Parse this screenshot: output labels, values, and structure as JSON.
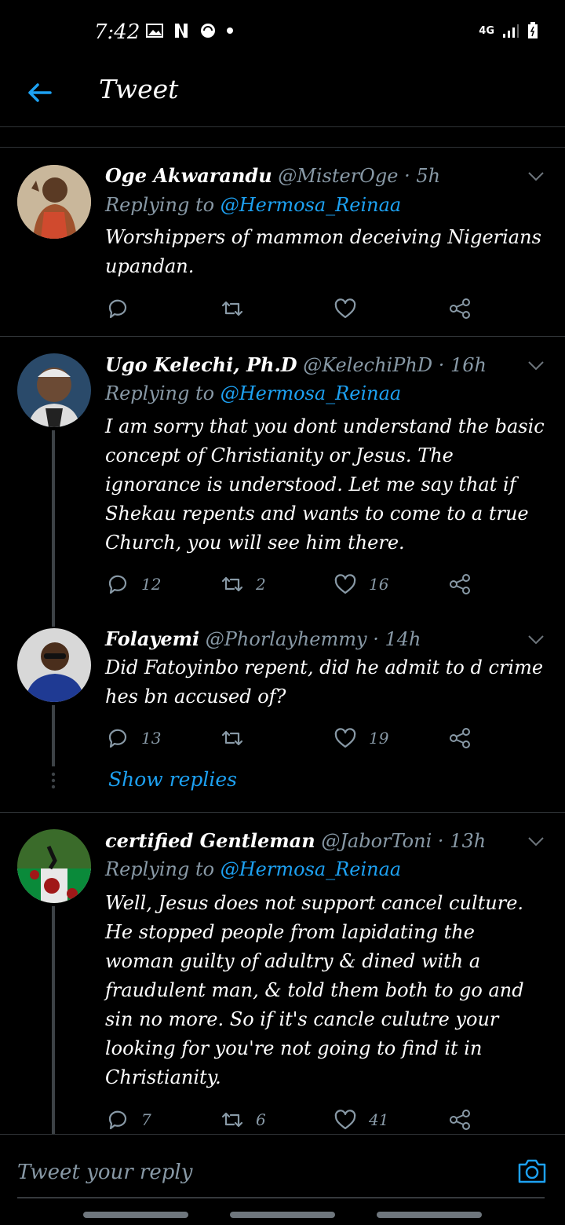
{
  "status_bar": {
    "time": "7:42",
    "network": "4G"
  },
  "header": {
    "title": "Tweet"
  },
  "tweets": [
    {
      "name": "Oge Akwarandu",
      "handle": "@MisterOge",
      "time": "5h",
      "replying_label": "Replying to",
      "replying_to": "@Hermosa_Reinaa",
      "text": "Worshippers of mammon deceiving Nigerians upandan.",
      "replies": "",
      "retweets": "",
      "likes": ""
    },
    {
      "name": "Ugo Kelechi, Ph.D",
      "handle": "@KelechiPhD",
      "time": "16h",
      "replying_label": "Replying to",
      "replying_to": "@Hermosa_Reinaa",
      "text": "I am sorry that you dont understand the basic concept of Christianity or Jesus. The ignorance is understood. Let me say that if Shekau repents and wants to come to a true Church, you will see him there.",
      "replies": "12",
      "retweets": "2",
      "likes": "16"
    },
    {
      "name": "Folayemi",
      "handle": "@Phorlayhemmy",
      "time": "14h",
      "text": "Did Fatoyinbo repent, did he admit to d crime hes bn accused of?",
      "replies": "13",
      "retweets": "",
      "likes": "19"
    },
    {
      "name": "certified Gentleman",
      "handle": "@JaborToni",
      "time": "13h",
      "replying_label": "Replying to",
      "replying_to": "@Hermosa_Reinaa",
      "text": "Well, Jesus does not support cancel culture. He stopped people from lapidating the woman guilty of adultry & dined with a fraudulent man, & told them both to go and sin no more. So if it's cancle culutre your looking for you're not going to find it in Christianity.",
      "replies": "7",
      "retweets": "6",
      "likes": "41"
    }
  ],
  "show_replies": "Show replies",
  "composer": {
    "placeholder": "Tweet your reply"
  },
  "colors": {
    "accent": "#1da1f2",
    "muted": "#8899a6",
    "divider": "#2f3336",
    "background": "#000000"
  },
  "icons": [
    "back-arrow-icon",
    "chevron-down-icon",
    "reply-icon",
    "retweet-icon",
    "like-icon",
    "share-icon",
    "camera-icon"
  ]
}
